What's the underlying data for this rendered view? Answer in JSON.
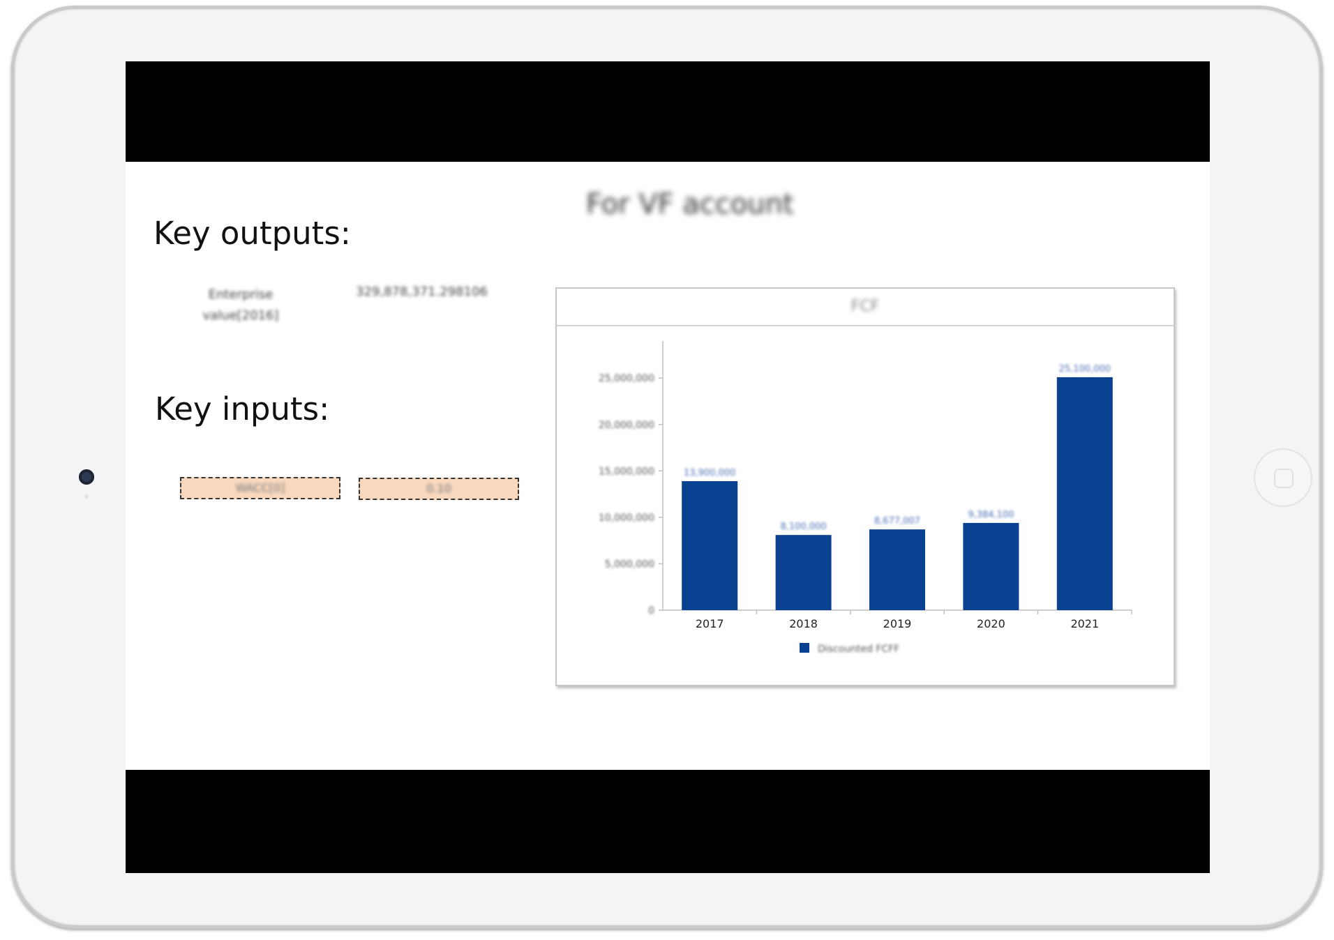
{
  "slide": {
    "title": "For VF account",
    "outputs_heading": "Key outputs:",
    "inputs_heading": "Key inputs:",
    "output_label": "Enterprise value[2016]",
    "output_value": "329,878,371.298106",
    "inputs": [
      {
        "label": "WACC[0]"
      },
      {
        "value": "0.10"
      }
    ]
  },
  "chart_data": {
    "type": "bar",
    "title": "FCF",
    "categories": [
      "2017",
      "2018",
      "2019",
      "2020",
      "2021"
    ],
    "series": [
      {
        "name": "Discounted FCFF",
        "values": [
          13900000,
          8100000,
          8700000,
          9400000,
          25100000
        ],
        "data_labels": [
          "13,900,000",
          "8,100,000",
          "8,677,007",
          "9,384,100",
          "25,100,000"
        ]
      }
    ],
    "yticks": [
      "0",
      "5,000,000",
      "10,000,000",
      "15,000,000",
      "20,000,000",
      "25,000,000"
    ],
    "ylim": [
      0,
      29000000
    ],
    "color": "#0b4191",
    "legend_position": "bottom",
    "grid": false
  }
}
